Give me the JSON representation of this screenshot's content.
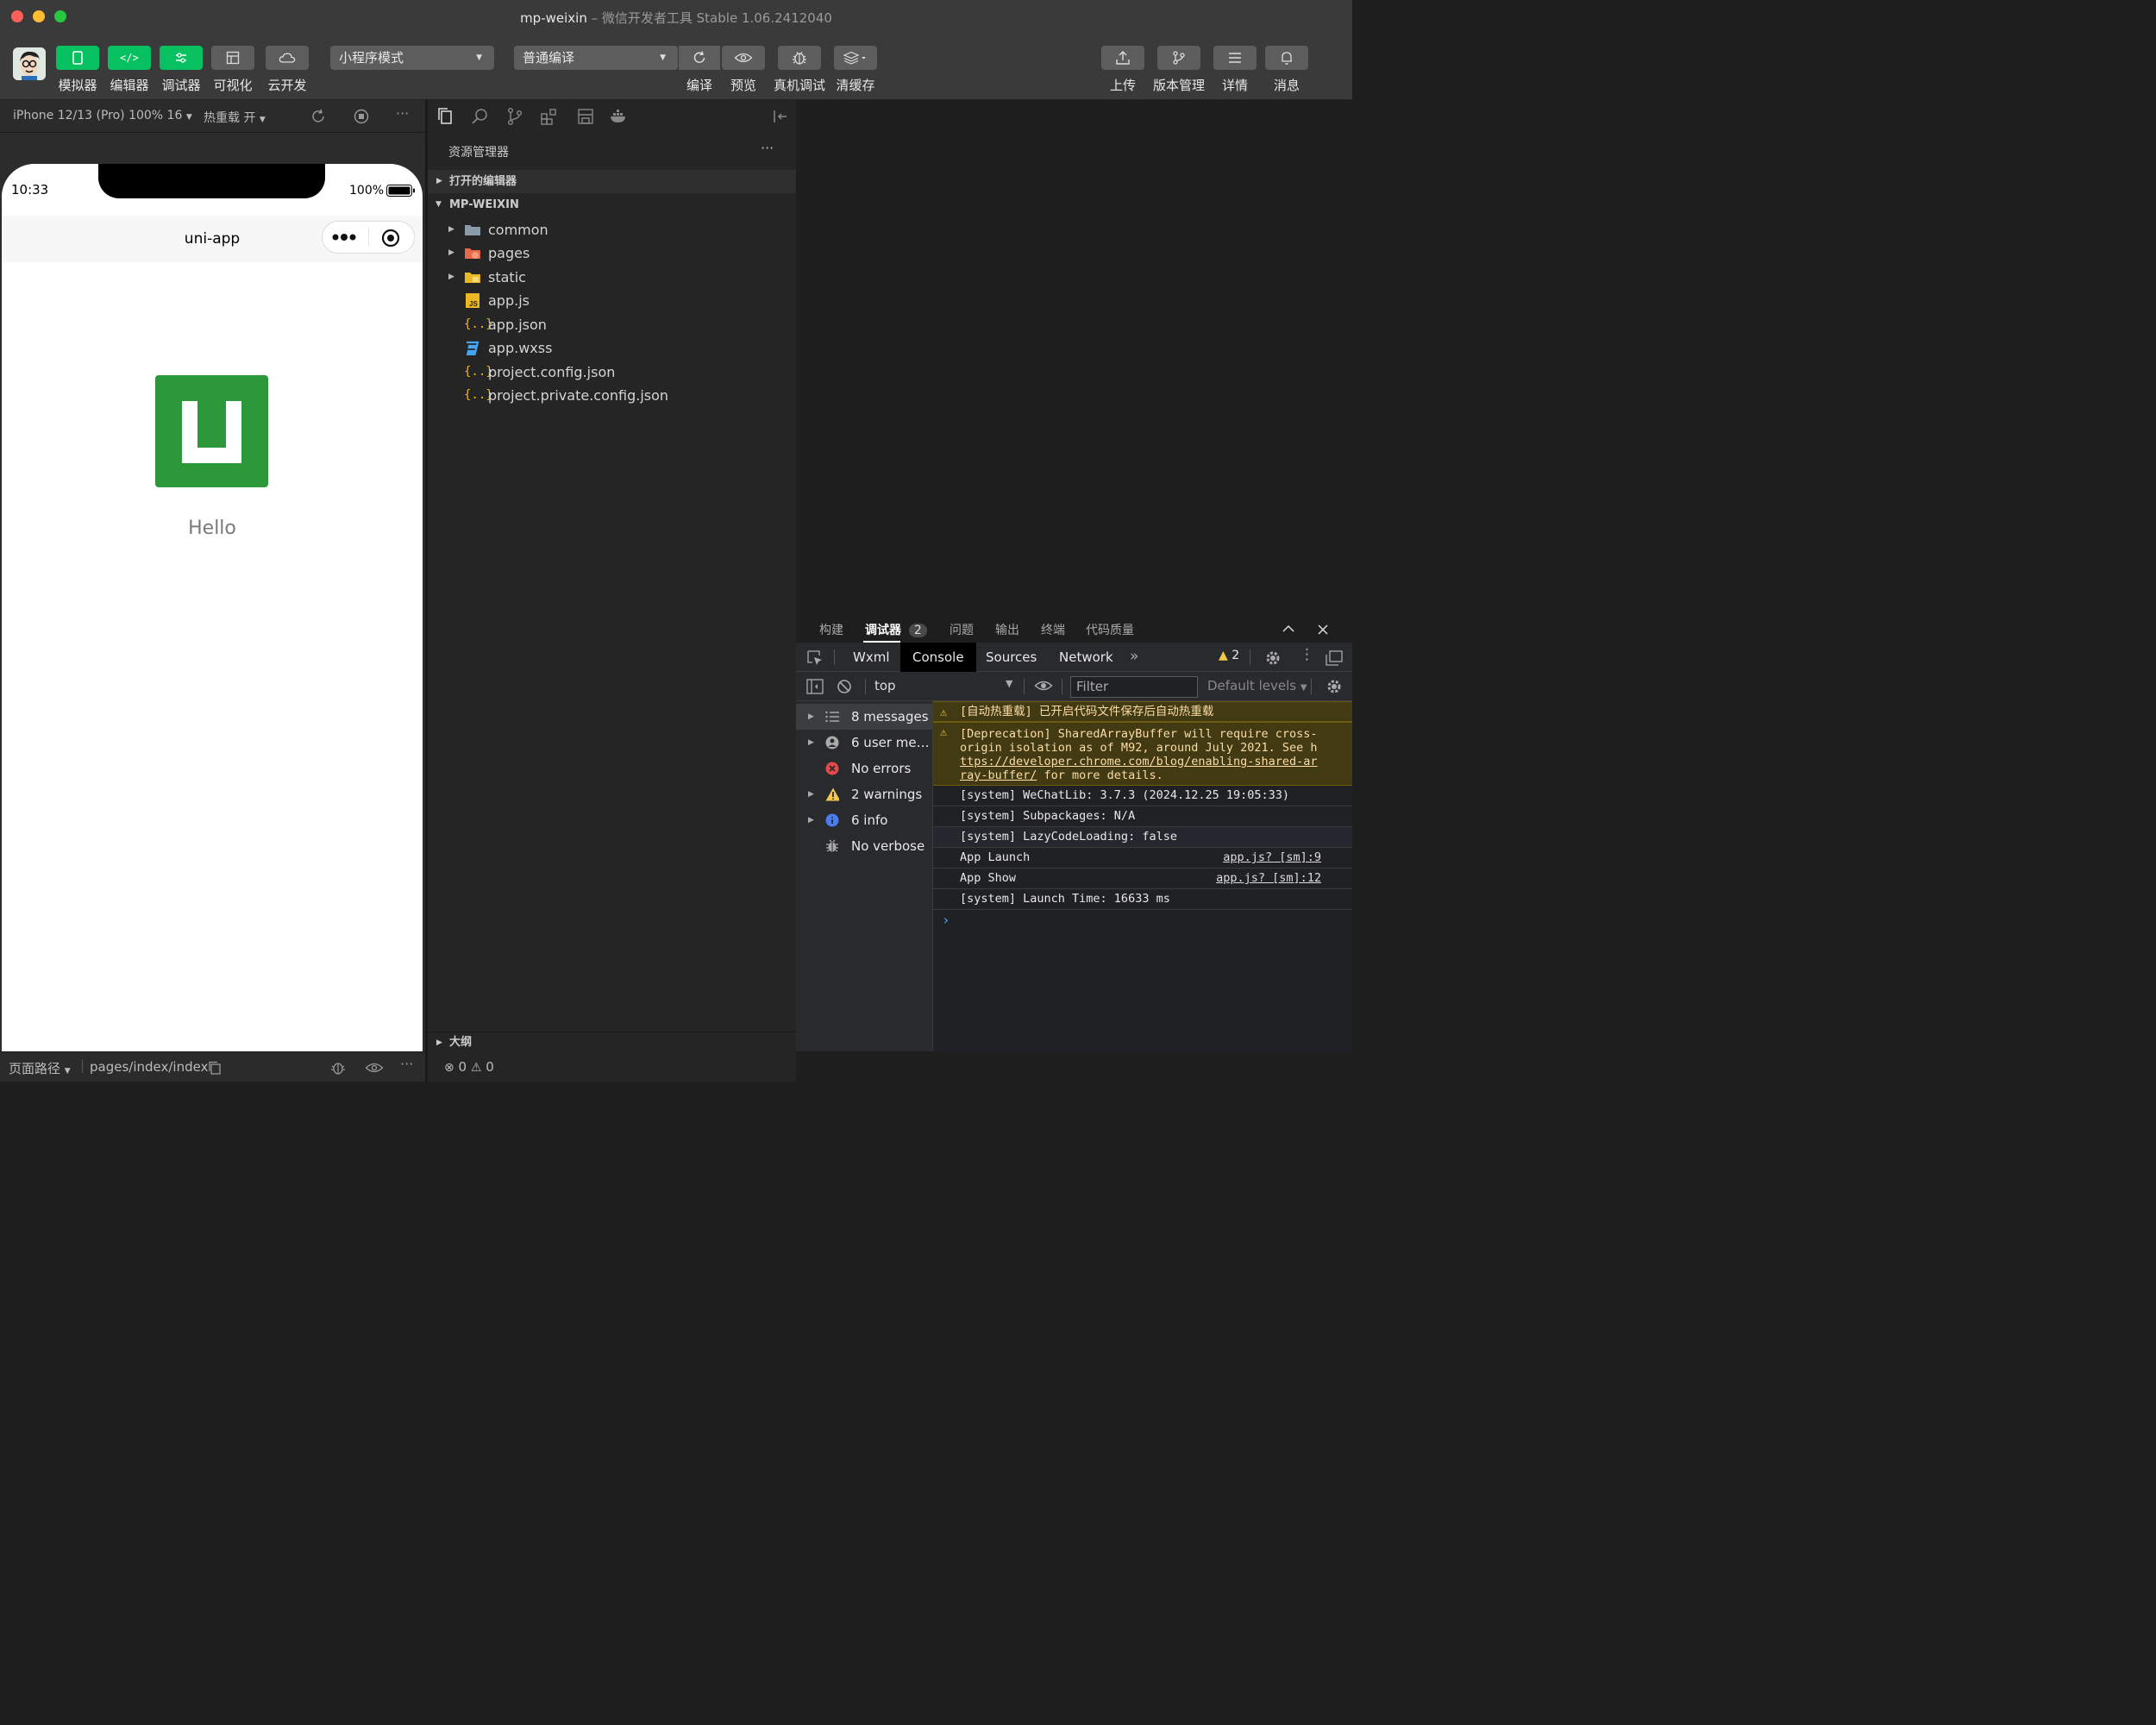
{
  "window": {
    "title_main": "mp-weixin",
    "title_sub": "微信开发者工具 Stable 1.06.2412040"
  },
  "toolbar": {
    "left_buttons": [
      {
        "label": "模拟器",
        "icon": "phone-icon"
      },
      {
        "label": "编辑器",
        "icon": "code-icon"
      },
      {
        "label": "调试器",
        "icon": "sliders-icon"
      },
      {
        "label": "可视化",
        "icon": "layout-icon"
      },
      {
        "label": "云开发",
        "icon": "cloud-icon"
      }
    ],
    "mode_select": "小程序模式",
    "compile_select": "普通编译",
    "mid_buttons": [
      {
        "label": "编译",
        "icon": "refresh-icon"
      },
      {
        "label": "预览",
        "icon": "eye-icon"
      },
      {
        "label": "真机调试",
        "icon": "bug-icon"
      },
      {
        "label": "清缓存",
        "icon": "layers-icon"
      }
    ],
    "right_buttons": [
      {
        "label": "上传",
        "icon": "upload-icon"
      },
      {
        "label": "版本管理",
        "icon": "branch-icon"
      },
      {
        "label": "详情",
        "icon": "menu-icon"
      },
      {
        "label": "消息",
        "icon": "bell-icon"
      }
    ]
  },
  "simulator": {
    "device": "iPhone 12/13 (Pro) 100% 16",
    "hot_reload": "热重载 开",
    "time": "10:33",
    "battery": "100%",
    "nav_title": "uni-app",
    "hello": "Hello",
    "footer_path_label": "页面路径",
    "footer_path": "pages/index/index"
  },
  "explorer": {
    "title": "资源管理器",
    "open_editors": "打开的编辑器",
    "project": "MP-WEIXIN",
    "items": [
      {
        "name": "common",
        "type": "folder"
      },
      {
        "name": "pages",
        "type": "folder-pages"
      },
      {
        "name": "static",
        "type": "folder-static"
      },
      {
        "name": "app.js",
        "type": "js"
      },
      {
        "name": "app.json",
        "type": "json"
      },
      {
        "name": "app.wxss",
        "type": "css"
      },
      {
        "name": "project.config.json",
        "type": "json"
      },
      {
        "name": "project.private.config.json",
        "type": "json"
      }
    ],
    "outline": "大纲",
    "status_errors": "0",
    "status_warnings": "0"
  },
  "panel": {
    "tabs": [
      "构建",
      "调试器",
      "问题",
      "输出",
      "终端",
      "代码质量"
    ],
    "debugger_badge": "2",
    "dev_tabs": [
      "Wxml",
      "Console",
      "Sources",
      "Network"
    ],
    "warn_count": "2",
    "context": "top",
    "filter_placeholder": "Filter",
    "levels": "Default levels",
    "sidebar": [
      {
        "label": "8 messages",
        "icon": "list-icon"
      },
      {
        "label": "6 user mes…",
        "icon": "user-icon"
      },
      {
        "label": "No errors",
        "icon": "error-icon"
      },
      {
        "label": "2 warnings",
        "icon": "warning-icon"
      },
      {
        "label": "6 info",
        "icon": "info-icon"
      },
      {
        "label": "No verbose",
        "icon": "bug-icon"
      }
    ],
    "logs": {
      "warn1": "[自动热重载] 已开启代码文件保存后自动热重载",
      "warn2_a": "[Deprecation] SharedArrayBuffer will require cross-",
      "warn2_b": "origin isolation as of M92, around July 2021. See h",
      "warn2_link1": "ttps://developer.chrome.com/blog/enabling-shared-ar",
      "warn2_link2": "ray-buffer/",
      "warn2_tail": " for more details.",
      "l1": "[system] WeChatLib: 3.7.3 (2024.12.25 19:05:33)",
      "l2": "[system] Subpackages: N/A",
      "l3": "[system] LazyCodeLoading: false",
      "l4": "App Launch",
      "l4_src": "app.js? [sm]:9",
      "l5": "App Show",
      "l5_src": "app.js? [sm]:12",
      "l6": "[system] Launch Time: 16633 ms",
      "prompt": "›"
    }
  }
}
